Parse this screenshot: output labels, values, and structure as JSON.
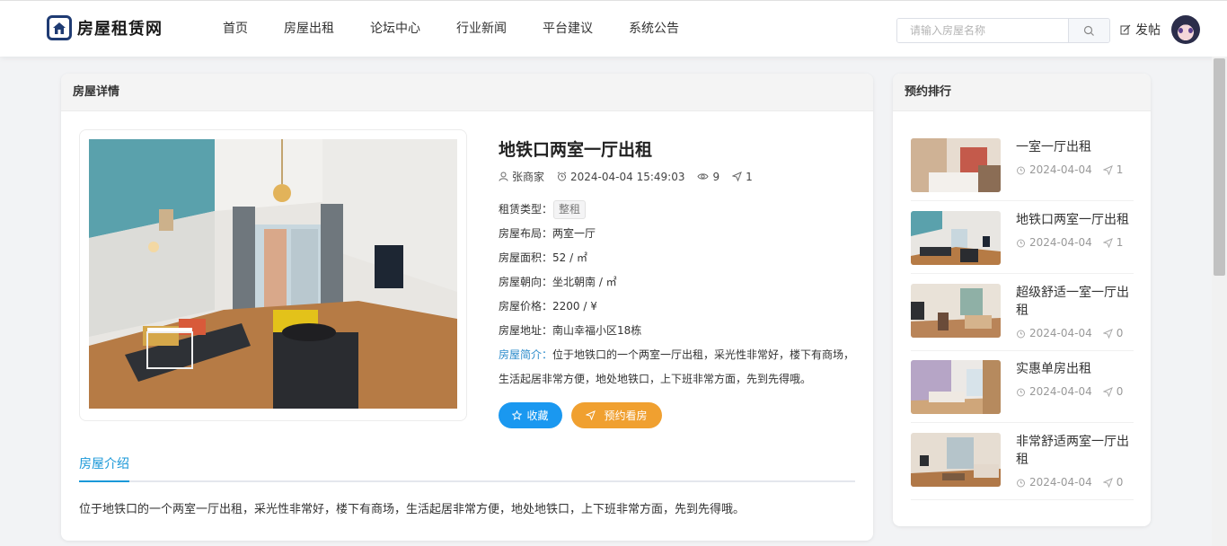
{
  "header": {
    "site_name": "房屋租赁网",
    "nav": [
      {
        "label": "首页"
      },
      {
        "label": "房屋出租"
      },
      {
        "label": "论坛中心"
      },
      {
        "label": "行业新闻"
      },
      {
        "label": "平台建议"
      },
      {
        "label": "系统公告"
      }
    ],
    "search_placeholder": "请输入房屋名称",
    "post_label": "发帖"
  },
  "detail": {
    "section_title": "房屋详情",
    "title": "地铁口两室一厅出租",
    "author": "张商家",
    "datetime": "2024-04-04 15:49:03",
    "views": "9",
    "bookings": "1",
    "attrs": {
      "type_label": "租赁类型：",
      "type_value": "整租",
      "layout": "房屋布局：两室一厅",
      "area": "房屋面积：52 / ㎡",
      "orientation": "房屋朝向：坐北朝南 / ㎡",
      "price": "房屋价格：2200 / ¥",
      "address": "房屋地址：南山幸福小区18栋"
    },
    "intro_label": "房屋简介：",
    "intro_text": "位于地铁口的一个两室一厅出租，采光性非常好，楼下有商场，生活起居非常方便，地处地铁口，上下班非常方面，先到先得哦。",
    "fav_label": "收藏",
    "book_label": "预约看房",
    "tab_label": "房屋介绍",
    "description": "位于地铁口的一个两室一厅出租，采光性非常好，楼下有商场，生活起居非常方便，地处地铁口，上下班非常方面，先到先得哦。"
  },
  "ranking": {
    "title": "预约排行",
    "items": [
      {
        "title": "一室一厅出租",
        "date": "2024-04-04",
        "count": "1"
      },
      {
        "title": "地铁口两室一厅出租",
        "date": "2024-04-04",
        "count": "1"
      },
      {
        "title": "超级舒适一室一厅出租",
        "date": "2024-04-04",
        "count": "0"
      },
      {
        "title": "实惠单房出租",
        "date": "2024-04-04",
        "count": "0"
      },
      {
        "title": "非常舒适两室一厅出租",
        "date": "2024-04-04",
        "count": "0"
      }
    ]
  },
  "colors": {
    "primary_blue": "#1a98f0",
    "booking_orange": "#f0a030",
    "logo_navy": "#1f3b73"
  }
}
